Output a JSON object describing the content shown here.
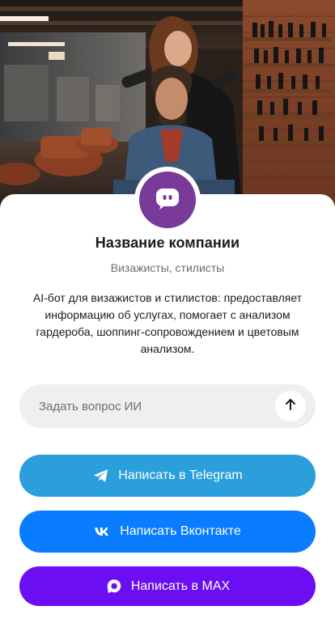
{
  "hero": {
    "image_alt_name": "salon-photo"
  },
  "company": {
    "name": "Название компании",
    "category": "Визажисты, стилисты",
    "description": "AI-бот для визажистов и стилистов: предоставляет информацию об услугах, помогает с анализом гардероба, шоппинг-сопровождением и цветовым анализом.",
    "avatar_icon": "chat-bot-icon",
    "avatar_color": "#7a3a99"
  },
  "ask": {
    "placeholder": "Задать вопрос ИИ",
    "send_icon": "arrow-up-icon"
  },
  "buttons": {
    "telegram": {
      "label": "Написать в Telegram",
      "icon": "telegram-icon",
      "color": "#2b9fdc"
    },
    "vk": {
      "label": "Написать Вконтакте",
      "icon": "vk-icon",
      "color": "#0a7cff"
    },
    "max": {
      "label": "Написать в MAX",
      "icon": "max-icon",
      "color": "#6b0ff2"
    }
  }
}
